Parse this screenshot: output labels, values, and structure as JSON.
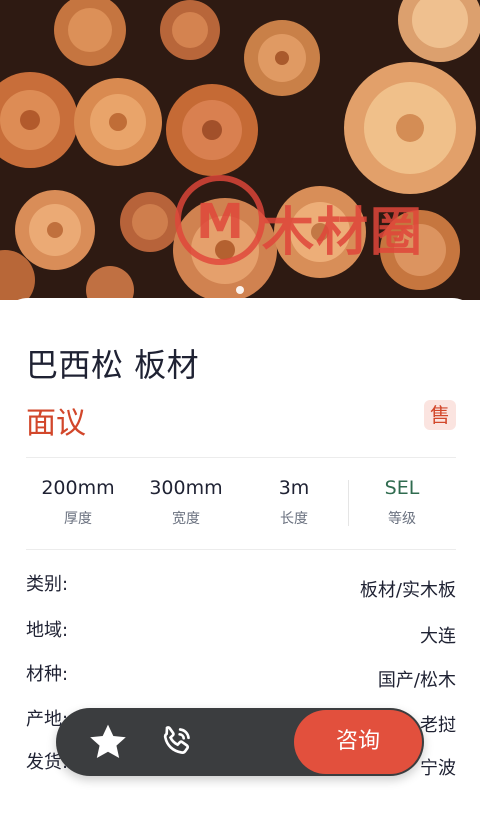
{
  "hero": {
    "logo_text": "木材圈",
    "image_description": "Stack of cut log ends",
    "slide_indicator": "1"
  },
  "product": {
    "title": "巴西松 板材",
    "price": "面议",
    "sale_badge": "售"
  },
  "specs": [
    {
      "value": "200mm",
      "label": "厚度"
    },
    {
      "value": "300mm",
      "label": "宽度"
    },
    {
      "value": "3m",
      "label": "长度"
    },
    {
      "value": "SEL",
      "label": "等级"
    }
  ],
  "details": [
    {
      "key": "类别:",
      "value": "板材/实木板"
    },
    {
      "key": "地域:",
      "value": "大连"
    },
    {
      "key": "材种:",
      "value": "国产/松木"
    },
    {
      "key": "产地:",
      "value": "老挝"
    },
    {
      "key": "发货:",
      "value": "宁波"
    }
  ],
  "actions": {
    "favorite_icon": "star-icon",
    "call_icon": "phone-icon",
    "consult_label": "咨询"
  },
  "colors": {
    "accent": "#e2503d",
    "price": "#d2472b",
    "grade": "#2f6b4f",
    "bar": "#3b3d3f"
  }
}
